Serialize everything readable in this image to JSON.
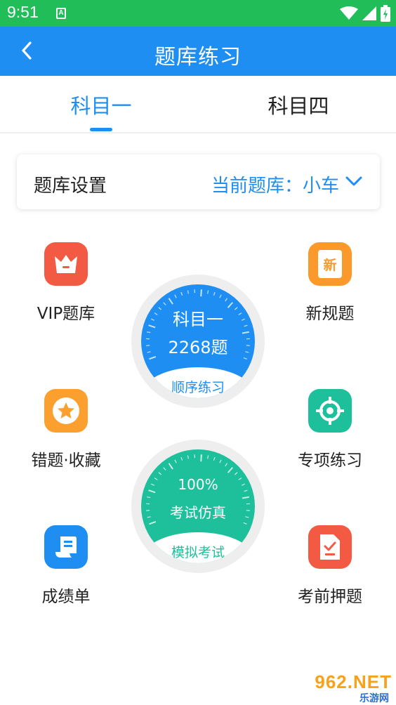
{
  "status_bar": {
    "time": "9:51",
    "notification_glyph": "A",
    "icons": [
      "wifi-icon",
      "signal-icon",
      "battery-icon"
    ]
  },
  "app_bar": {
    "title": "题库练习",
    "back_icon": "chevron-left-icon"
  },
  "tabs": [
    {
      "label": "科目一",
      "active": true
    },
    {
      "label": "科目四",
      "active": false
    }
  ],
  "settings": {
    "label": "题库设置",
    "current_value": "当前题库：小车"
  },
  "features": {
    "vip": {
      "label": "VIP题库",
      "icon": "crown-icon",
      "color": "#f35a44"
    },
    "new_rules": {
      "label": "新规题",
      "icon": "new-document-icon",
      "icon_text": "新",
      "color": "#fb9a2a"
    },
    "mistakes": {
      "label": "错题·收藏",
      "icon": "star-icon",
      "color": "#fba02e"
    },
    "special": {
      "label": "专项练习",
      "icon": "target-icon",
      "color": "#1ec09b"
    },
    "report": {
      "label": "成绩单",
      "icon": "scroll-icon",
      "color": "#1e8ef3"
    },
    "pre_exam": {
      "label": "考前押题",
      "icon": "checklist-icon",
      "color": "#f35a44"
    }
  },
  "sequential_dial": {
    "subject": "科目一",
    "count": "2268题",
    "action": "顺序练习",
    "color": "#1e8ef3"
  },
  "exam_dial": {
    "percent": "100%",
    "subtitle": "考试仿真",
    "action": "模拟考试",
    "color": "#1ec09b"
  },
  "watermark": {
    "main": "962.NET",
    "sub": "乐游网"
  }
}
